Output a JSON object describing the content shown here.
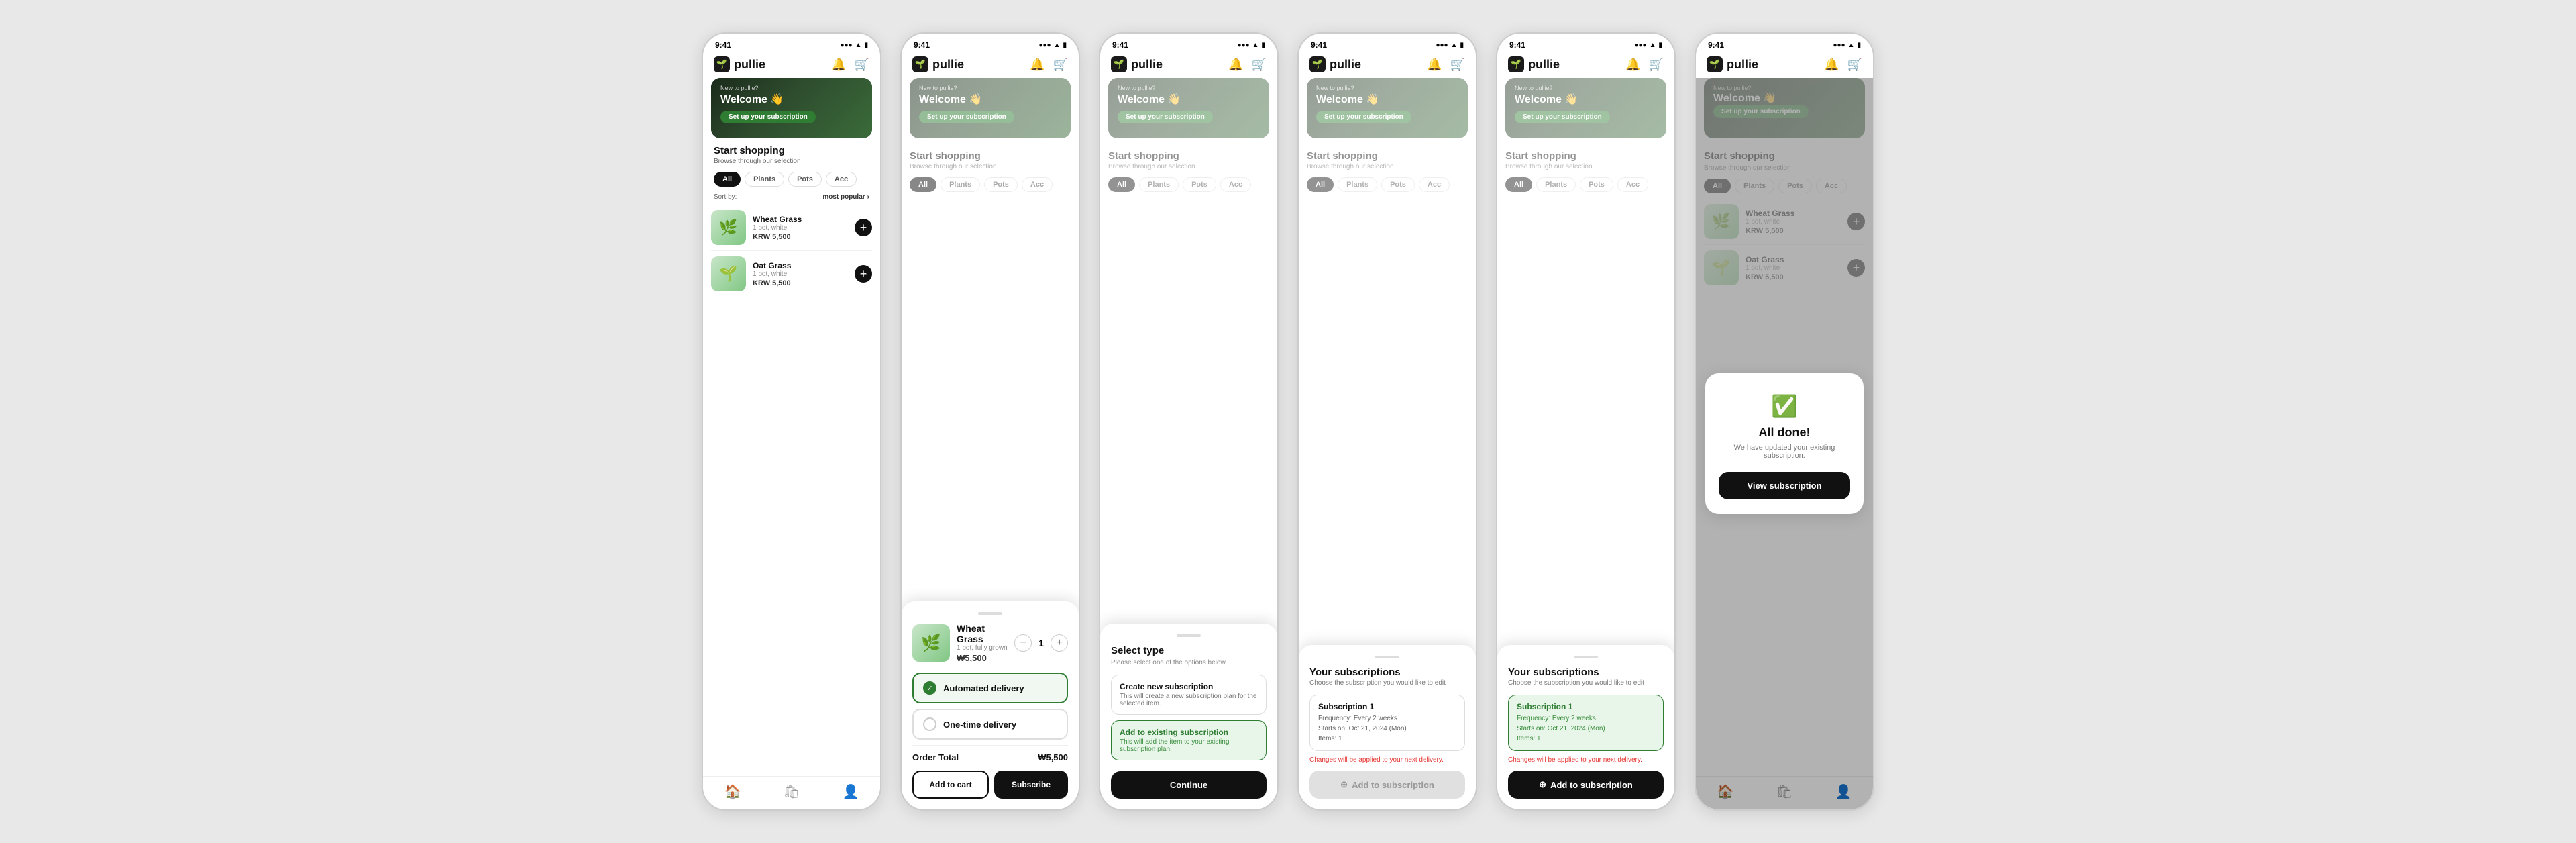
{
  "app": {
    "name": "pullie",
    "logo_icon": "🌱",
    "status_time": "9:41",
    "status_signal": "●●●",
    "status_wifi": "▲",
    "status_battery": "■"
  },
  "hero": {
    "new_text": "New to pullie?",
    "welcome": "Welcome 👋",
    "cta": "Set up your subscription"
  },
  "shopping": {
    "title": "Start shopping",
    "subtitle": "Browse through our selection",
    "sort_label": "Sort by:",
    "sort_value": "most popular",
    "filters": [
      "All",
      "Plants",
      "Pots",
      "Acc"
    ]
  },
  "products": [
    {
      "name": "Wheat Grass",
      "desc": "1 pot, white",
      "price": "KRW 5,500",
      "emoji": "🌿"
    },
    {
      "name": "Oat Grass",
      "desc": "1 pot, white",
      "price": "KRW 5,500",
      "emoji": "🌱"
    }
  ],
  "nav": {
    "home": "🏠",
    "shop": "🛍",
    "profile": "👤"
  },
  "product_detail": {
    "name": "Wheat Grass",
    "desc": "1 pot, fully grown",
    "price": "₩5,500",
    "quantity": 1,
    "delivery_options": [
      {
        "label": "Automated delivery",
        "selected": true
      },
      {
        "label": "One-time delivery",
        "selected": false
      }
    ],
    "order_total_label": "Order Total",
    "order_total_value": "₩5,500",
    "btn_cart": "Add to cart",
    "btn_subscribe": "Subscribe"
  },
  "select_type": {
    "title": "Select type",
    "subtitle": "Please select one of the options below",
    "options": [
      {
        "label": "Create new subscription",
        "desc": "This will create a new subscription plan for the selected item.",
        "selected": false
      },
      {
        "label": "Add to existing subscription",
        "desc": "This will add the item to your existing subscription plan.",
        "selected": true
      }
    ],
    "continue_btn": "Continue"
  },
  "subscriptions_inactive": {
    "title": "Your subscriptions",
    "subtitle": "Choose the subscription you would like to edit",
    "items": [
      {
        "name": "Subscription 1",
        "frequency": "Every 2 weeks",
        "starts": "Oct 21, 2024 (Mon)",
        "items_count": "1",
        "selected": false
      }
    ],
    "changes_note": "Changes will be applied to your next delivery.",
    "add_btn": "Add to subscription",
    "add_btn_disabled": true
  },
  "subscriptions_active": {
    "title": "Your subscriptions",
    "subtitle": "Choose the subscription you would like to edit",
    "items": [
      {
        "name": "Subscription 1",
        "frequency": "Every 2 weeks",
        "starts": "Oct 21, 2024 (Mon)",
        "items_count": "1",
        "selected": true
      }
    ],
    "changes_note": "Changes will be applied to your next delivery.",
    "add_btn": "Add to subscription",
    "add_btn_disabled": false
  },
  "all_done": {
    "title": "All done!",
    "desc": "We have updated your existing subscription.",
    "view_btn": "View subscription"
  },
  "labels": {
    "frequency_prefix": "Frequency:  ",
    "starts_prefix": "Starts on:  ",
    "items_prefix": "Items:  "
  }
}
